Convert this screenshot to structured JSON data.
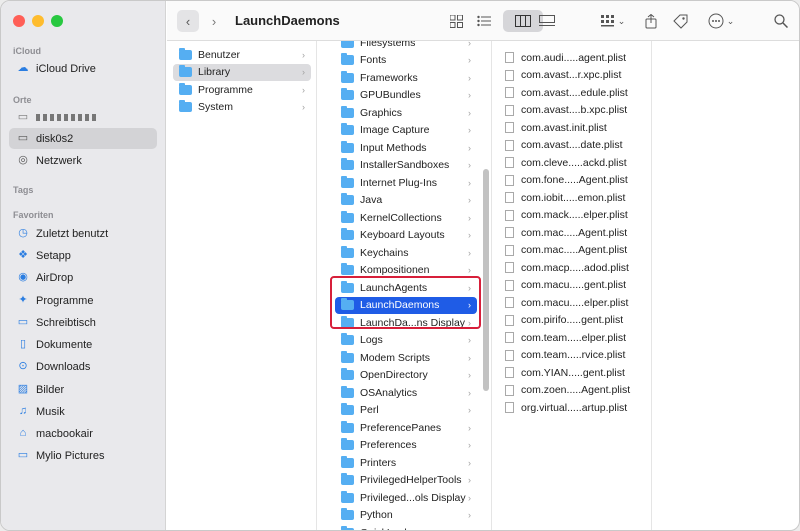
{
  "toolbar": {
    "title": "LaunchDaemons",
    "back_icon": "chevron-left-icon",
    "forward_icon": "chevron-right-icon"
  },
  "sidebar": {
    "icloud_label": "iCloud",
    "icloud_items": [
      {
        "label": "iCloud Drive",
        "icon": "☁"
      }
    ],
    "orte_label": "Orte",
    "orte_items": [
      {
        "label": "disk0s2",
        "icon": "▭",
        "selected": true
      },
      {
        "label": "Netzwerk",
        "icon": "◎"
      }
    ],
    "tags_label": "Tags",
    "favoriten_label": "Favoriten",
    "favoriten_items": [
      {
        "label": "Zuletzt benutzt",
        "icon": "◷"
      },
      {
        "label": "Setapp",
        "icon": "❖"
      },
      {
        "label": "AirDrop",
        "icon": "◉"
      },
      {
        "label": "Programme",
        "icon": "✦"
      },
      {
        "label": "Schreibtisch",
        "icon": "▭"
      },
      {
        "label": "Dokumente",
        "icon": "▯"
      },
      {
        "label": "Downloads",
        "icon": "⊙"
      },
      {
        "label": "Bilder",
        "icon": "▨"
      },
      {
        "label": "Musik",
        "icon": "♫"
      },
      {
        "label": "macbookair",
        "icon": "⌂"
      },
      {
        "label": "Mylio Pictures",
        "icon": "▭"
      }
    ]
  },
  "columns": {
    "col1": [
      {
        "label": "Benutzer"
      },
      {
        "label": "Library",
        "selected": "gray"
      },
      {
        "label": "Programme"
      },
      {
        "label": "System"
      }
    ],
    "col2": [
      {
        "label": "Filesystems"
      },
      {
        "label": "Fonts"
      },
      {
        "label": "Frameworks"
      },
      {
        "label": "GPUBundles"
      },
      {
        "label": "Graphics"
      },
      {
        "label": "Image Capture"
      },
      {
        "label": "Input Methods"
      },
      {
        "label": "InstallerSandboxes"
      },
      {
        "label": "Internet Plug-Ins"
      },
      {
        "label": "Java"
      },
      {
        "label": "KernelCollections"
      },
      {
        "label": "Keyboard Layouts"
      },
      {
        "label": "Keychains"
      },
      {
        "label": "Kompositionen"
      },
      {
        "label": "LaunchAgents"
      },
      {
        "label": "LaunchDaemons",
        "selected": "blue"
      },
      {
        "label": "LaunchDa...ns Display"
      },
      {
        "label": "Logs"
      },
      {
        "label": "Modem Scripts"
      },
      {
        "label": "OpenDirectory"
      },
      {
        "label": "OSAnalytics"
      },
      {
        "label": "Perl"
      },
      {
        "label": "PreferencePanes"
      },
      {
        "label": "Preferences"
      },
      {
        "label": "Printers"
      },
      {
        "label": "PrivilegedHelperTools"
      },
      {
        "label": "Privileged...ols Display"
      },
      {
        "label": "Python"
      },
      {
        "label": "QuickLook"
      }
    ],
    "col3": [
      {
        "label": "com.audi.....agent.plist"
      },
      {
        "label": "com.avast...r.xpc.plist"
      },
      {
        "label": "com.avast....edule.plist"
      },
      {
        "label": "com.avast....b.xpc.plist"
      },
      {
        "label": "com.avast.init.plist"
      },
      {
        "label": "com.avast....date.plist"
      },
      {
        "label": "com.cleve.....ackd.plist"
      },
      {
        "label": "com.fone.....Agent.plist"
      },
      {
        "label": "com.iobit.....emon.plist"
      },
      {
        "label": "com.mack.....elper.plist"
      },
      {
        "label": "com.mac.....Agent.plist"
      },
      {
        "label": "com.mac.....Agent.plist"
      },
      {
        "label": "com.macp.....adod.plist"
      },
      {
        "label": "com.macu.....gent.plist"
      },
      {
        "label": "com.macu.....elper.plist"
      },
      {
        "label": "com.pirifo.....gent.plist"
      },
      {
        "label": "com.team.....elper.plist"
      },
      {
        "label": "com.team.....rvice.plist"
      },
      {
        "label": "com.YIAN.....gent.plist"
      },
      {
        "label": "com.zoen.....Agent.plist"
      },
      {
        "label": "org.virtual.....artup.plist"
      }
    ]
  }
}
